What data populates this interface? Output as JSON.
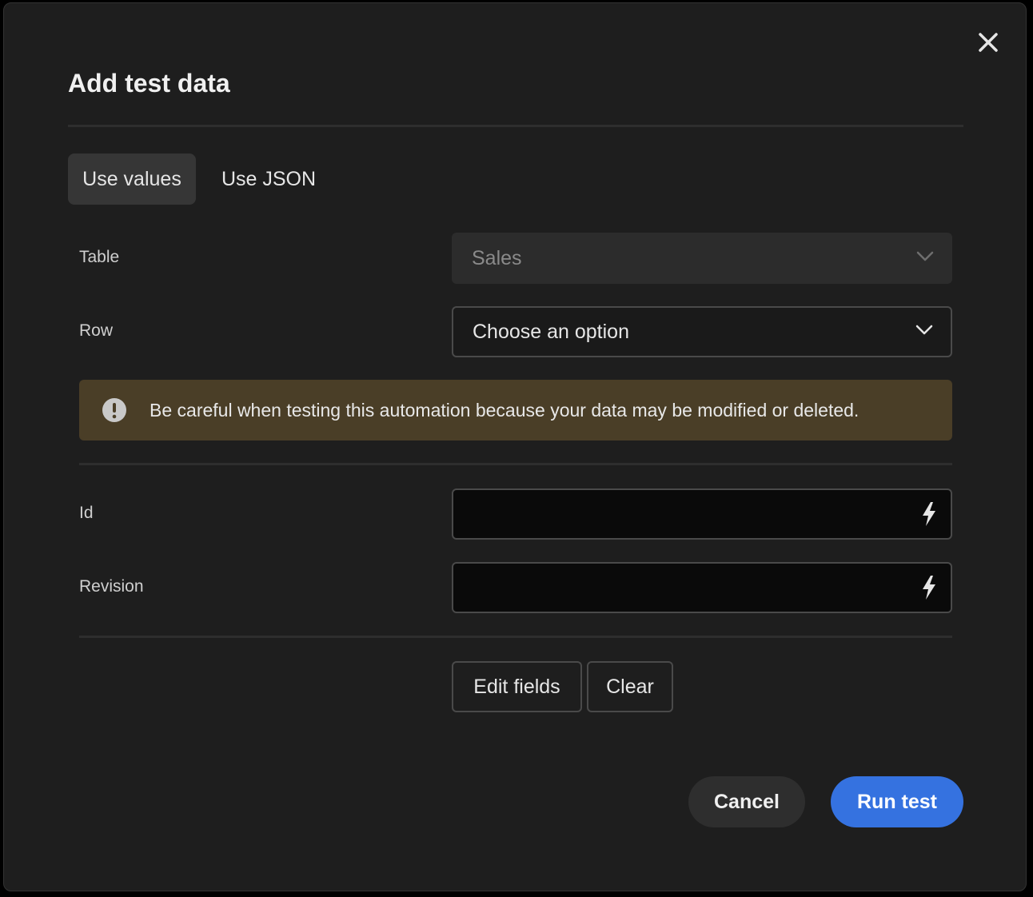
{
  "dialog": {
    "title": "Add test data",
    "close_icon": "close-icon"
  },
  "tabs": [
    {
      "label": "Use values",
      "active": true
    },
    {
      "label": "Use JSON",
      "active": false
    }
  ],
  "fields": {
    "table": {
      "label": "Table",
      "value": "Sales",
      "disabled": true
    },
    "row": {
      "label": "Row",
      "placeholder": "Choose an option"
    },
    "id": {
      "label": "Id",
      "value": ""
    },
    "revision": {
      "label": "Revision",
      "value": ""
    }
  },
  "warning": {
    "icon": "exclamation-circle-icon",
    "text": "Be careful when testing this automation because your data may be modified or deleted.",
    "color": "#4a3e27"
  },
  "field_actions": {
    "edit_label": "Edit fields",
    "clear_label": "Clear"
  },
  "footer": {
    "cancel_label": "Cancel",
    "run_label": "Run test",
    "accent_color": "#3572e0"
  }
}
